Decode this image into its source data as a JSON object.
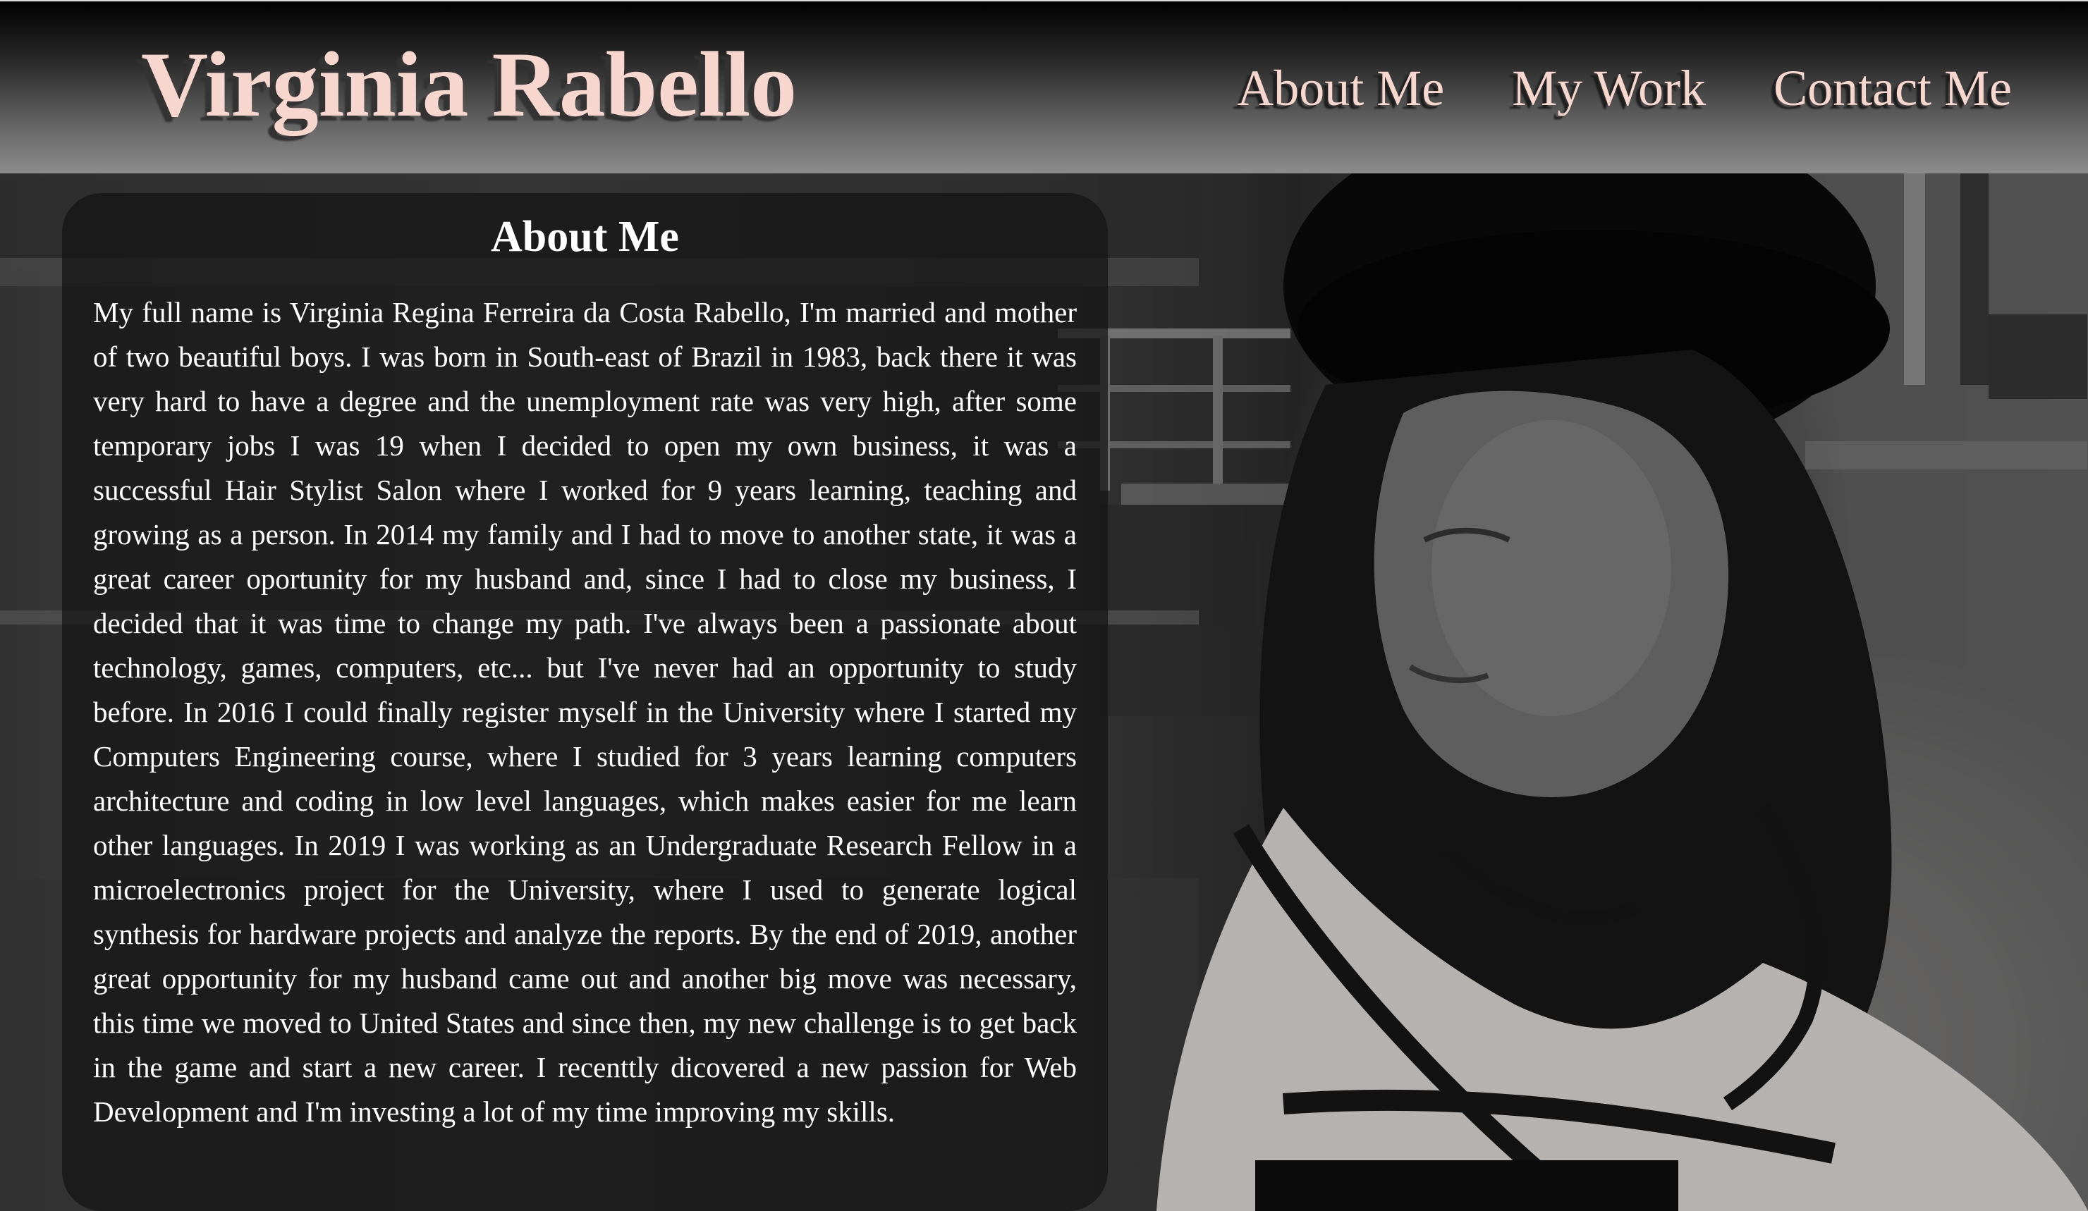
{
  "header": {
    "site_title": "Virginia Rabello",
    "nav": [
      {
        "label": "About Me"
      },
      {
        "label": "My Work"
      },
      {
        "label": "Contact Me"
      }
    ]
  },
  "about": {
    "heading": "About Me",
    "body": "My full name is Virginia Regina Ferreira da Costa Rabello, I'm married and mother of two beautiful boys. I was born in South-east of Brazil in 1983, back there it was very hard to have a degree and the unemployment rate was very high, after some temporary jobs I was 19 when I decided to open my own business, it was a successful Hair Stylist Salon where I worked for 9 years learning, teaching and growing as a person. In 2014 my family and I had to move to another state, it was a great career oportunity for my husband and, since I had to close my business, I decided that it was time to change my path. I've always been a passionate about technology, games, computers, etc... but I've never had an opportunity to study before. In 2016 I could finally register myself in the University where I started my Computers Engineering course, where I studied for 3 years learning computers architecture and coding in low level languages, which makes easier for me learn other languages. In 2019 I was working as an Undergraduate Research Fellow in a microelectronics project for the University, where I used to generate logical synthesis for hardware projects and analyze the reports. By the end of 2019, another great opportunity for my husband came out and another big move was necessary, this time we moved to United States and since then, my new challenge is to get back in the game and start a new career. I recenttly dicovered a new passion for Web Development and I'm investing a lot of my time improving my skills."
  },
  "colors": {
    "title_pink": "#f7d6ce",
    "header_top": "#000000",
    "header_bottom": "#8c8c8c",
    "card_bg": "rgba(20,20,20,0.72)",
    "body_text": "#ffffff"
  }
}
